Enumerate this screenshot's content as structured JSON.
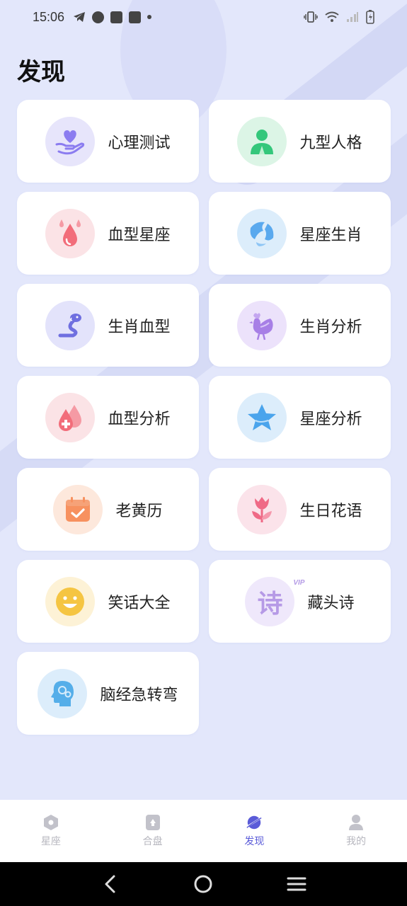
{
  "status_bar": {
    "time": "15:06"
  },
  "page": {
    "title": "发现"
  },
  "cards": [
    {
      "label": "心理测试",
      "icon": "heart-hand-icon",
      "color": "#8b7cf0",
      "bg": "#e7e5fb"
    },
    {
      "label": "九型人格",
      "icon": "person-icon",
      "color": "#34c77b",
      "bg": "#dcf5e6"
    },
    {
      "label": "血型星座",
      "icon": "blood-drops-icon",
      "color": "#f26d7a",
      "bg": "#fbe3e6"
    },
    {
      "label": "星座生肖",
      "icon": "globe-icon",
      "color": "#5aa9ee",
      "bg": "#dcedfb"
    },
    {
      "label": "生肖血型",
      "icon": "snake-icon",
      "color": "#6f6fe0",
      "bg": "#e3e3fb"
    },
    {
      "label": "生肖分析",
      "icon": "rooster-icon",
      "color": "#a77fe6",
      "bg": "#ece2fb"
    },
    {
      "label": "血型分析",
      "icon": "blood-drop-cross-icon",
      "color": "#f26d7a",
      "bg": "#fbe3e6"
    },
    {
      "label": "星座分析",
      "icon": "star-icon",
      "color": "#4aa4ec",
      "bg": "#dcedfb"
    },
    {
      "label": "老黄历",
      "icon": "calendar-icon",
      "color": "#f7915f",
      "bg": "#fde8dc"
    },
    {
      "label": "生日花语",
      "icon": "tulip-icon",
      "color": "#ef6a86",
      "bg": "#fbe3ea"
    },
    {
      "label": "笑话大全",
      "icon": "smile-icon",
      "color": "#f5c542",
      "bg": "#fdf2d6"
    },
    {
      "label": "藏头诗",
      "icon": "poem-char-icon",
      "color": "#b69ae6",
      "bg": "#efe8fb",
      "badge": "VIP",
      "char": "诗"
    },
    {
      "label": "脑经急转弯",
      "icon": "brain-head-icon",
      "color": "#55aee9",
      "bg": "#dcedfb"
    }
  ],
  "tabbar": {
    "items": [
      {
        "label": "星座",
        "icon": "hexagon-icon",
        "active": false
      },
      {
        "label": "合盘",
        "icon": "card-icon",
        "active": false
      },
      {
        "label": "发现",
        "icon": "planet-icon",
        "active": true
      },
      {
        "label": "我的",
        "icon": "user-icon",
        "active": false
      }
    ]
  },
  "navbar": {
    "items": [
      "back-icon",
      "home-icon",
      "menu-icon"
    ]
  }
}
